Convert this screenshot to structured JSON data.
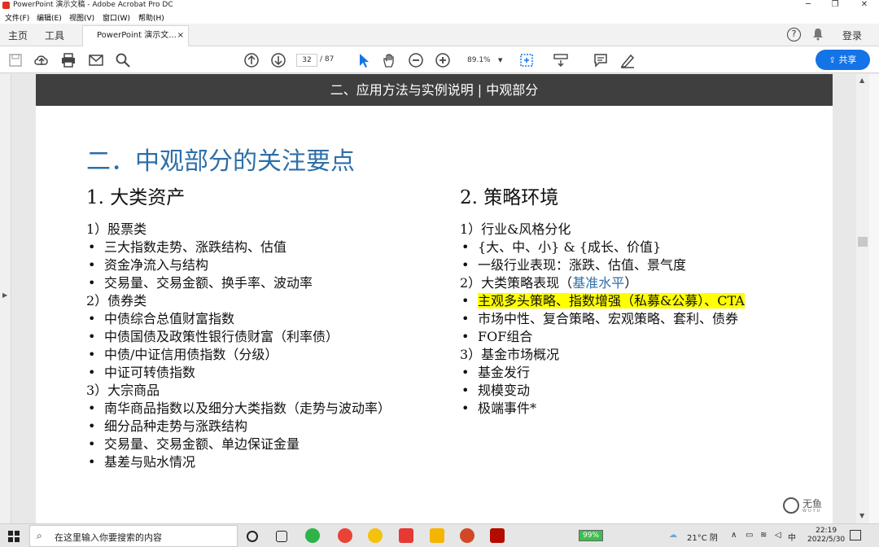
{
  "window": {
    "title": "PowerPoint 演示文稿 - Adobe Acrobat Pro DC",
    "controls": {
      "minimize": "─",
      "maximize": "❐",
      "close": "✕"
    }
  },
  "menu": [
    "文件(F)",
    "编辑(E)",
    "视图(V)",
    "窗口(W)",
    "帮助(H)"
  ],
  "tabs": {
    "home": "主页",
    "tools": "工具",
    "doc_tab": "PowerPoint 演示文...",
    "doc_tab_close": "×",
    "help": "?",
    "login": "登录"
  },
  "toolbar": {
    "page_current": "32",
    "page_total": "/ 87",
    "zoom": "89.1%",
    "share_label": "共享"
  },
  "slide": {
    "banner": "二、应用方法与实例说明 | 中观部分",
    "title": "二．中观部分的关注要点",
    "left": {
      "heading": "1. 大类资产",
      "lines": [
        {
          "t": "1）股票类",
          "b": false
        },
        {
          "t": "三大指数走势、涨跌结构、估值",
          "b": true
        },
        {
          "t": "资金净流入与结构",
          "b": true
        },
        {
          "t": "交易量、交易金额、换手率、波动率",
          "b": true
        },
        {
          "t": "2）债券类",
          "b": false
        },
        {
          "t": "中债综合总值财富指数",
          "b": true
        },
        {
          "t": "中债国债及政策性银行债财富（利率债）",
          "b": true
        },
        {
          "t": "中债/中证信用债指数（分级）",
          "b": true
        },
        {
          "t": "中证可转债指数",
          "b": true
        },
        {
          "t": "3）大宗商品",
          "b": false
        },
        {
          "t": "南华商品指数以及细分大类指数（走势与波动率）",
          "b": true
        },
        {
          "t": "细分品种走势与涨跌结构",
          "b": true
        },
        {
          "t": "交易量、交易金额、单边保证金量",
          "b": true
        },
        {
          "t": "基差与贴水情况",
          "b": true
        }
      ]
    },
    "right": {
      "heading": "2. 策略环境",
      "lines": [
        {
          "t": "1）行业&风格分化",
          "b": false
        },
        {
          "t": "{大、中、小} & {成长、价值}",
          "b": true
        },
        {
          "t": "一级行业表现：涨跌、估值、景气度",
          "b": true
        },
        {
          "t": "2）大类策略表现（",
          "b": false,
          "link": "基准水平",
          "tail": "）"
        },
        {
          "t": "主观多头策略、指数增强（私募&公募）、CTA",
          "b": true,
          "hl": true
        },
        {
          "t": "市场中性、复合策略、宏观策略、套利、债券",
          "b": true
        },
        {
          "t": "FOF组合",
          "b": true
        },
        {
          "t": "3）基金市场概况",
          "b": false
        },
        {
          "t": "基金发行",
          "b": true
        },
        {
          "t": "规模变动",
          "b": true
        },
        {
          "t": "极端事件*",
          "b": true
        }
      ]
    },
    "logo_text": "无鱼",
    "logo_sub": "WUYU",
    "bullet_char": "•"
  },
  "taskbar": {
    "search_placeholder": "在这里输入你要搜索的内容",
    "battery": "99%",
    "weather": "21°C 阴",
    "ime": "中",
    "time": "22:19",
    "date": "2022/5/30"
  },
  "colors": {
    "title_blue": "#2e6fa8",
    "banner_bg": "#3f3f3f",
    "highlight": "#ffff00",
    "share_blue": "#1473e6"
  }
}
